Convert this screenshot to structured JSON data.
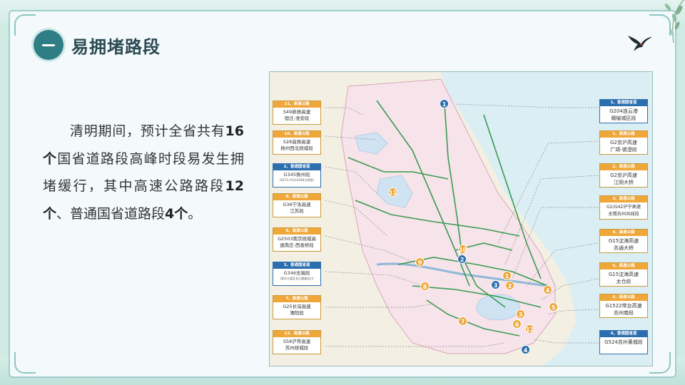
{
  "section": {
    "badge_symbol": "一",
    "title": "易拥堵路段"
  },
  "body_text": {
    "p1": "清明期间，预计全省共有",
    "num1": "16个",
    "p2": "国省道路段高峰时段易发生拥堵缓行，其中高速公路路段",
    "num2": "12个",
    "p3": "、普通国省道路段",
    "num3": "4个",
    "p4": "。"
  },
  "map": {
    "left_callouts": [
      {
        "tag": "11、高速公路",
        "name": "S49新扬高速\n宿迁-淮安段",
        "type": "highway"
      },
      {
        "tag": "10、高速公路",
        "name": "S28启扬高速\n扬州西北绕城段",
        "type": "highway"
      },
      {
        "tag": "2、普通国省道",
        "name": "G345扬州段",
        "sub": "(K271+514-K284大桥段)",
        "type": "national"
      },
      {
        "tag": "9、高速公路",
        "name": "G36宁洛高速\n江苏段",
        "type": "highway"
      },
      {
        "tag": "8、高速公路",
        "name": "G2503南京绕城高\n速南庄-西善桥段",
        "type": "highway"
      },
      {
        "tag": "3、普通国省道",
        "name": "G346无锡段",
        "sub": "(君乐大道至长江隧道出口)",
        "type": "national"
      },
      {
        "tag": "7、高速公路",
        "name": "G25长深高速\n溧阳段",
        "type": "highway"
      },
      {
        "tag": "12、高速公路",
        "name": "S58沪常高速\n苏州绕城段",
        "type": "highway"
      }
    ],
    "right_callouts": [
      {
        "tag": "1、普通国省道",
        "name": "G204连云港\n赣榆城区段",
        "type": "national"
      },
      {
        "tag": "1、高速公路",
        "name": "G2京沪高速\n广靖-锡澄段",
        "type": "highway"
      },
      {
        "tag": "2、高速公路",
        "name": "G2京沪高速\n江阴大桥",
        "type": "highway"
      },
      {
        "tag": "3、高速公路",
        "name": "G2/G42沪宁高速\n无锡苏州共线段",
        "type": "highway"
      },
      {
        "tag": "4、高速公路",
        "name": "G15沈海高速\n苏通大桥",
        "type": "highway"
      },
      {
        "tag": "5、高速公路",
        "name": "G15沈海高速\n太仓段",
        "type": "highway"
      },
      {
        "tag": "6、高速公路",
        "name": "G1522常台高速\n苏州南段",
        "type": "highway"
      },
      {
        "tag": "4、普通国省道",
        "name": "G524苏州黄城段",
        "type": "national"
      }
    ],
    "pins": [
      "1",
      "11",
      "10",
      "2",
      "9",
      "8",
      "3",
      "7",
      "12",
      "1",
      "2",
      "3",
      "4",
      "5",
      "6",
      "4"
    ]
  },
  "colors": {
    "accent": "#2f7e86",
    "highway_tag": "#f0a73a",
    "national_tag": "#2c6fae",
    "panel_bg": "#f4fafb",
    "title_text": "#2a4a52"
  },
  "icons": {
    "section_badge": "dash-badge-icon",
    "decoration_bird": "swallow-icon",
    "decoration_leaves": "willow-leaves-icon"
  }
}
